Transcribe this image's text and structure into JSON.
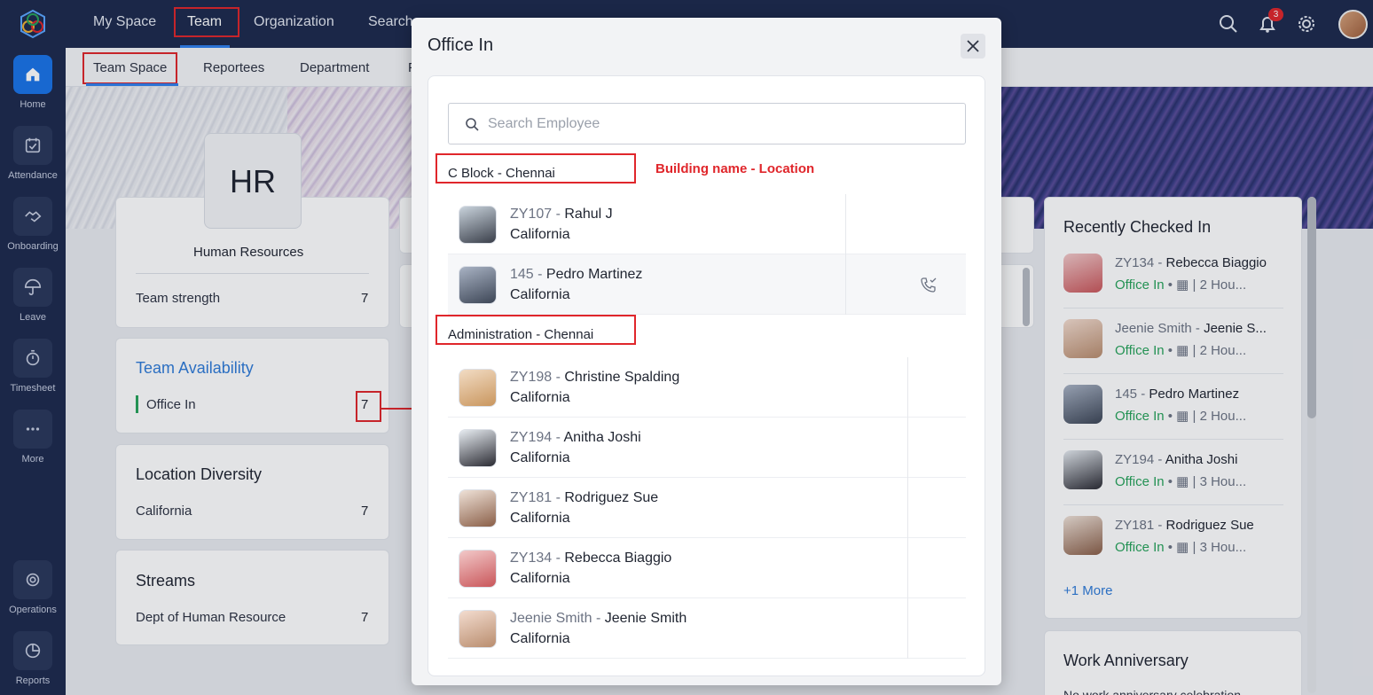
{
  "app": {
    "logo_icon": "zoho-people-logo-icon",
    "accent": "#1a73e8",
    "annotation_color": "#e0262b"
  },
  "sidebar": {
    "items": [
      {
        "label": "Home",
        "icon": "home-icon"
      },
      {
        "label": "Attendance",
        "icon": "calendar-check-icon"
      },
      {
        "label": "Onboarding",
        "icon": "handshake-icon"
      },
      {
        "label": "Leave",
        "icon": "umbrella-icon"
      },
      {
        "label": "Timesheet",
        "icon": "timer-icon"
      },
      {
        "label": "More",
        "icon": "more-dots-icon"
      },
      {
        "label": "Operations",
        "icon": "operations-icon"
      },
      {
        "label": "Reports",
        "icon": "pie-chart-icon"
      }
    ]
  },
  "topnav": {
    "tabs": [
      "My Space",
      "Team",
      "Organization",
      "Search"
    ],
    "notification_count": "3"
  },
  "subnav": {
    "tabs": [
      "Team Space",
      "Reportees",
      "Department",
      "F"
    ]
  },
  "team": {
    "initials": "HR",
    "name": "Human Resources",
    "strength_label": "Team strength",
    "strength_value": "7"
  },
  "availability": {
    "title": "Team Availability",
    "office_in_label": "Office In",
    "office_in_value": "7"
  },
  "location_diversity": {
    "title": "Location Diversity",
    "location": "California",
    "value": "7"
  },
  "streams": {
    "title": "Streams",
    "dept": "Dept of Human Resource",
    "value": "7"
  },
  "recently_checked_in": {
    "title": "Recently Checked In",
    "rows": [
      {
        "id": "ZY134",
        "name": "Rebecca Biaggio",
        "status": "Office In",
        "time": "2 Hou..."
      },
      {
        "id": "Jeenie Smith",
        "name": "Jeenie S...",
        "status": "Office In",
        "time": "2 Hou..."
      },
      {
        "id": "145",
        "name": "Pedro Martinez",
        "status": "Office In",
        "time": "2 Hou..."
      },
      {
        "id": "ZY194",
        "name": "Anitha Joshi",
        "status": "Office In",
        "time": "3 Hou..."
      },
      {
        "id": "ZY181",
        "name": "Rodriguez Sue",
        "status": "Office In",
        "time": "3 Hou..."
      }
    ],
    "more": "+1 More"
  },
  "work_anniversary": {
    "title": "Work Anniversary",
    "partial_text": "No work anniversary celebration"
  },
  "modal": {
    "title": "Office In",
    "search_placeholder": "Search Employee",
    "annotation": "Building name - Location",
    "groups": [
      {
        "header": "C Block - Chennai",
        "employees": [
          {
            "id": "ZY107",
            "name": "Rahul J",
            "location": "California"
          },
          {
            "id": "145",
            "name": "Pedro Martinez",
            "location": "California"
          }
        ]
      },
      {
        "header": "Administration - Chennai",
        "employees": [
          {
            "id": "ZY198",
            "name": "Christine Spalding",
            "location": "California"
          },
          {
            "id": "ZY194",
            "name": "Anitha Joshi",
            "location": "California"
          },
          {
            "id": "ZY181",
            "name": "Rodriguez Sue",
            "location": "California"
          },
          {
            "id": "ZY134",
            "name": "Rebecca Biaggio",
            "location": "California"
          },
          {
            "id": "Jeenie Smith",
            "name": "Jeenie Smith",
            "location": "California"
          }
        ]
      }
    ]
  }
}
